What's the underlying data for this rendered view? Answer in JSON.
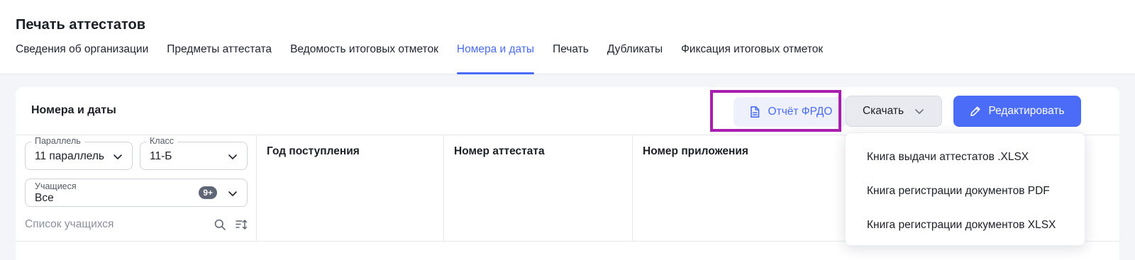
{
  "page": {
    "title": "Печать аттестатов"
  },
  "tabs": [
    {
      "label": "Сведения об организации",
      "active": false
    },
    {
      "label": "Предметы аттестата",
      "active": false
    },
    {
      "label": "Ведомость итоговых отметок",
      "active": false
    },
    {
      "label": "Номера и даты",
      "active": true
    },
    {
      "label": "Печать",
      "active": false
    },
    {
      "label": "Дубликаты",
      "active": false
    },
    {
      "label": "Фиксация итоговых отметок",
      "active": false
    }
  ],
  "card": {
    "title": "Номера и даты",
    "frdo_label": "Отчёт ФРДО",
    "download_label": "Скачать",
    "edit_label": "Редактировать"
  },
  "filters": {
    "parallel": {
      "label": "Параллель",
      "value": "11 параллель"
    },
    "class": {
      "label": "Класс",
      "value": "11-Б"
    },
    "students": {
      "label": "Учащиеся",
      "value": "Все",
      "badge": "9+"
    },
    "search_placeholder": "Список учащихся"
  },
  "columns": [
    "Год поступления",
    "Номер аттестата",
    "Номер приложения",
    "",
    ""
  ],
  "download_menu": [
    "Книга выдачи аттестатов .XLSX",
    "Книга регистрации документов PDF",
    "Книга регистрации документов XLSX"
  ],
  "colors": {
    "accent": "#4a6cf7",
    "highlight": "#a81fb0"
  },
  "icons": {
    "frdo": "document-icon",
    "download": "chevron-down-icon",
    "edit": "pencil-icon",
    "search": "search-icon",
    "sort": "sort-icon"
  }
}
